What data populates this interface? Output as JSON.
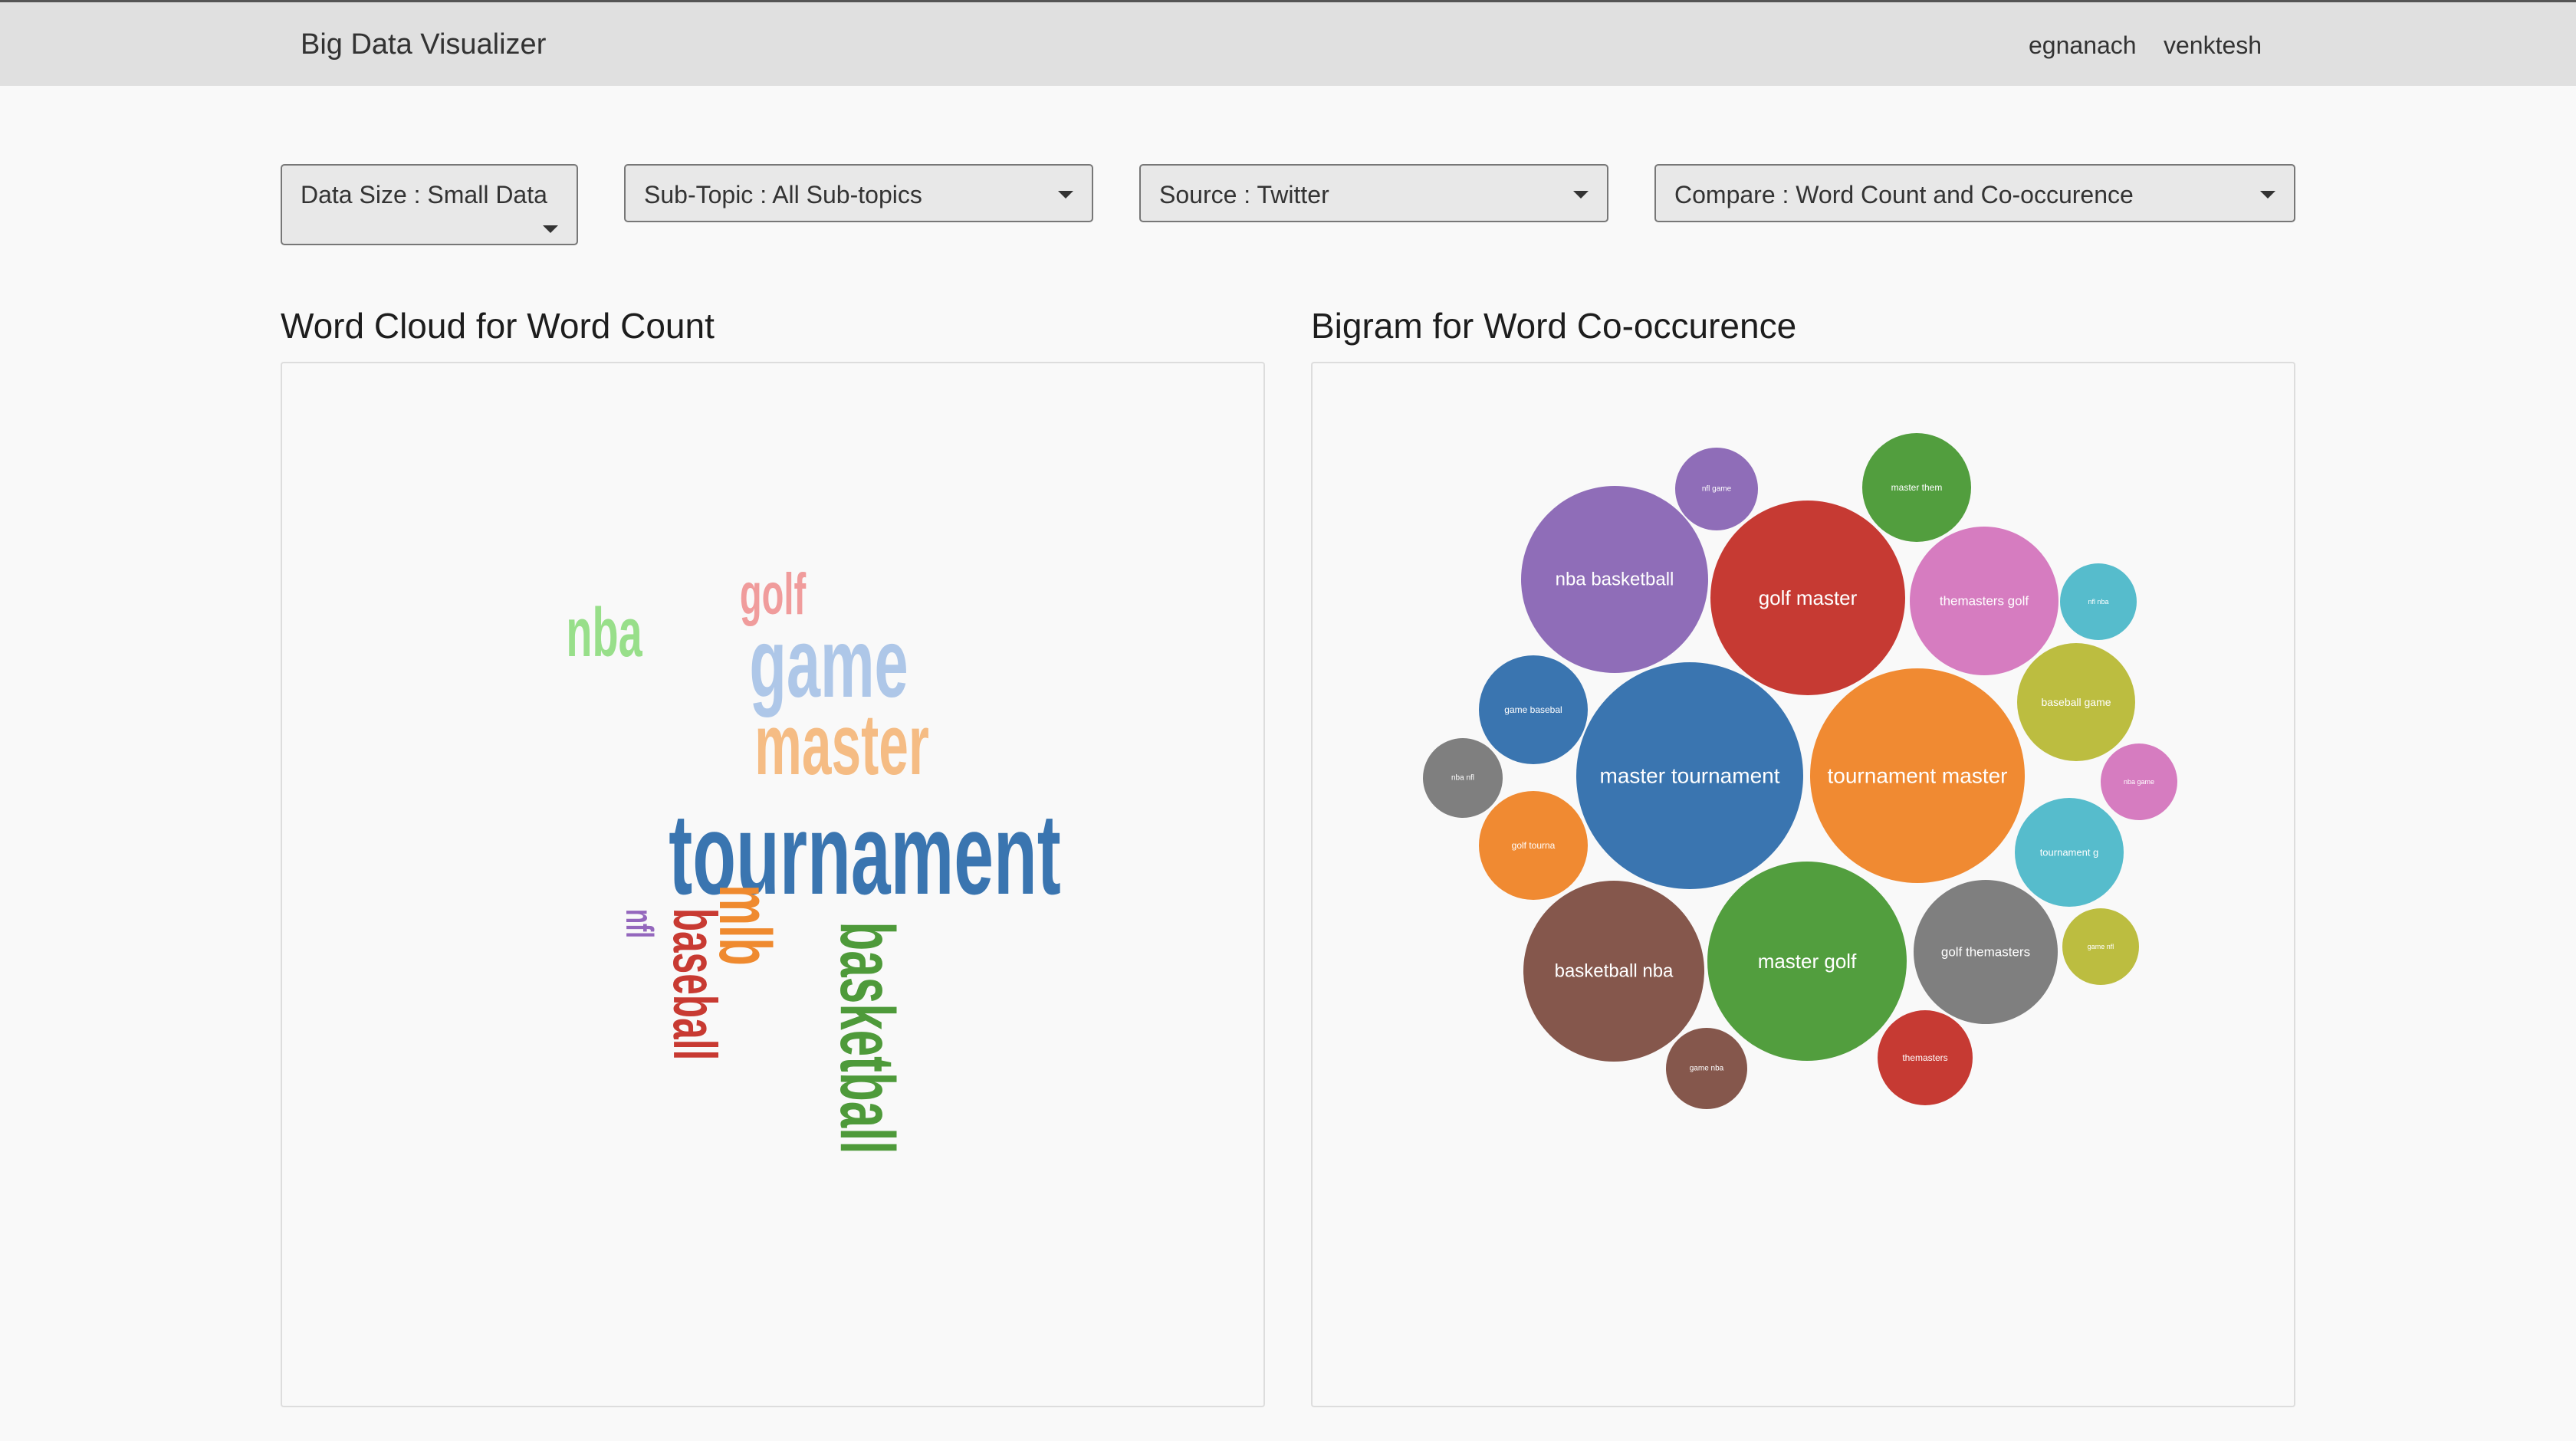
{
  "header": {
    "brand": "Big Data Visualizer",
    "links": [
      "egnanach",
      "venktesh"
    ]
  },
  "filters": {
    "data_size": "Data Size : Small Data",
    "sub_topic": "Sub-Topic : All Sub-topics",
    "source": "Source : Twitter",
    "compare": "Compare : Word Count and Co-occurence"
  },
  "panels": {
    "wordcloud_title": "Word Cloud for Word Count",
    "bigram_title": "Bigram for Word Co-occurence"
  },
  "chart_data": [
    {
      "type": "wordcloud",
      "title": "Word Cloud for Word Count",
      "words": [
        {
          "text": "tournament",
          "color": "#3a75b0",
          "rotated": false
        },
        {
          "text": "master",
          "color": "#f5bc84",
          "rotated": false
        },
        {
          "text": "game",
          "color": "#aec7e8",
          "rotated": false
        },
        {
          "text": "nba",
          "color": "#98df8a",
          "rotated": false
        },
        {
          "text": "golf",
          "color": "#f09c9c",
          "rotated": false
        },
        {
          "text": "basketball",
          "color": "#4e9a3a",
          "rotated": true
        },
        {
          "text": "mlb",
          "color": "#ef8a2f",
          "rotated": true
        },
        {
          "text": "baseball",
          "color": "#c83a32",
          "rotated": true
        },
        {
          "text": "nfl",
          "color": "#9467bd",
          "rotated": true
        }
      ]
    },
    {
      "type": "bubble",
      "title": "Bigram for Word Co-occurence",
      "bubbles": [
        {
          "label": "master tournament",
          "color": "#3a75b0",
          "value": 100
        },
        {
          "label": "tournament master",
          "color": "#f08a32",
          "value": 92
        },
        {
          "label": "master golf",
          "color": "#529e3e",
          "value": 81
        },
        {
          "label": "golf master",
          "color": "#c63a33",
          "value": 76
        },
        {
          "label": "basketball nba",
          "color": "#85574c",
          "value": 65
        },
        {
          "label": "nba basketball",
          "color": "#8f6db8",
          "value": 70
        },
        {
          "label": "golf themasters",
          "color": "#7f7f7f",
          "value": 42
        },
        {
          "label": "themasters golf",
          "color": "#d67cc0",
          "value": 43
        },
        {
          "label": "baseball game",
          "color": "#bcbd40",
          "value": 28
        },
        {
          "label": "tournament g",
          "color": "#56bccc",
          "value": 24
        },
        {
          "label": "game basebal",
          "color": "#3a75b0",
          "value": 24
        },
        {
          "label": "golf tourna",
          "color": "#f08a32",
          "value": 24
        },
        {
          "label": "master them",
          "color": "#529e3e",
          "value": 24
        },
        {
          "label": "themasters",
          "color": "#c63a33",
          "value": 18
        },
        {
          "label": "game nba",
          "color": "#85574c",
          "value": 13
        },
        {
          "label": "nfl game",
          "color": "#8f6db8",
          "value": 14
        },
        {
          "label": "nba nfl",
          "color": "#7f7f7f",
          "value": 13
        },
        {
          "label": "nfl nba",
          "color": "#56bccc",
          "value": 12
        },
        {
          "label": "nba game",
          "color": "#d67cc0",
          "value": 12
        },
        {
          "label": "game nfl",
          "color": "#bcbd40",
          "value": 12
        }
      ]
    }
  ]
}
